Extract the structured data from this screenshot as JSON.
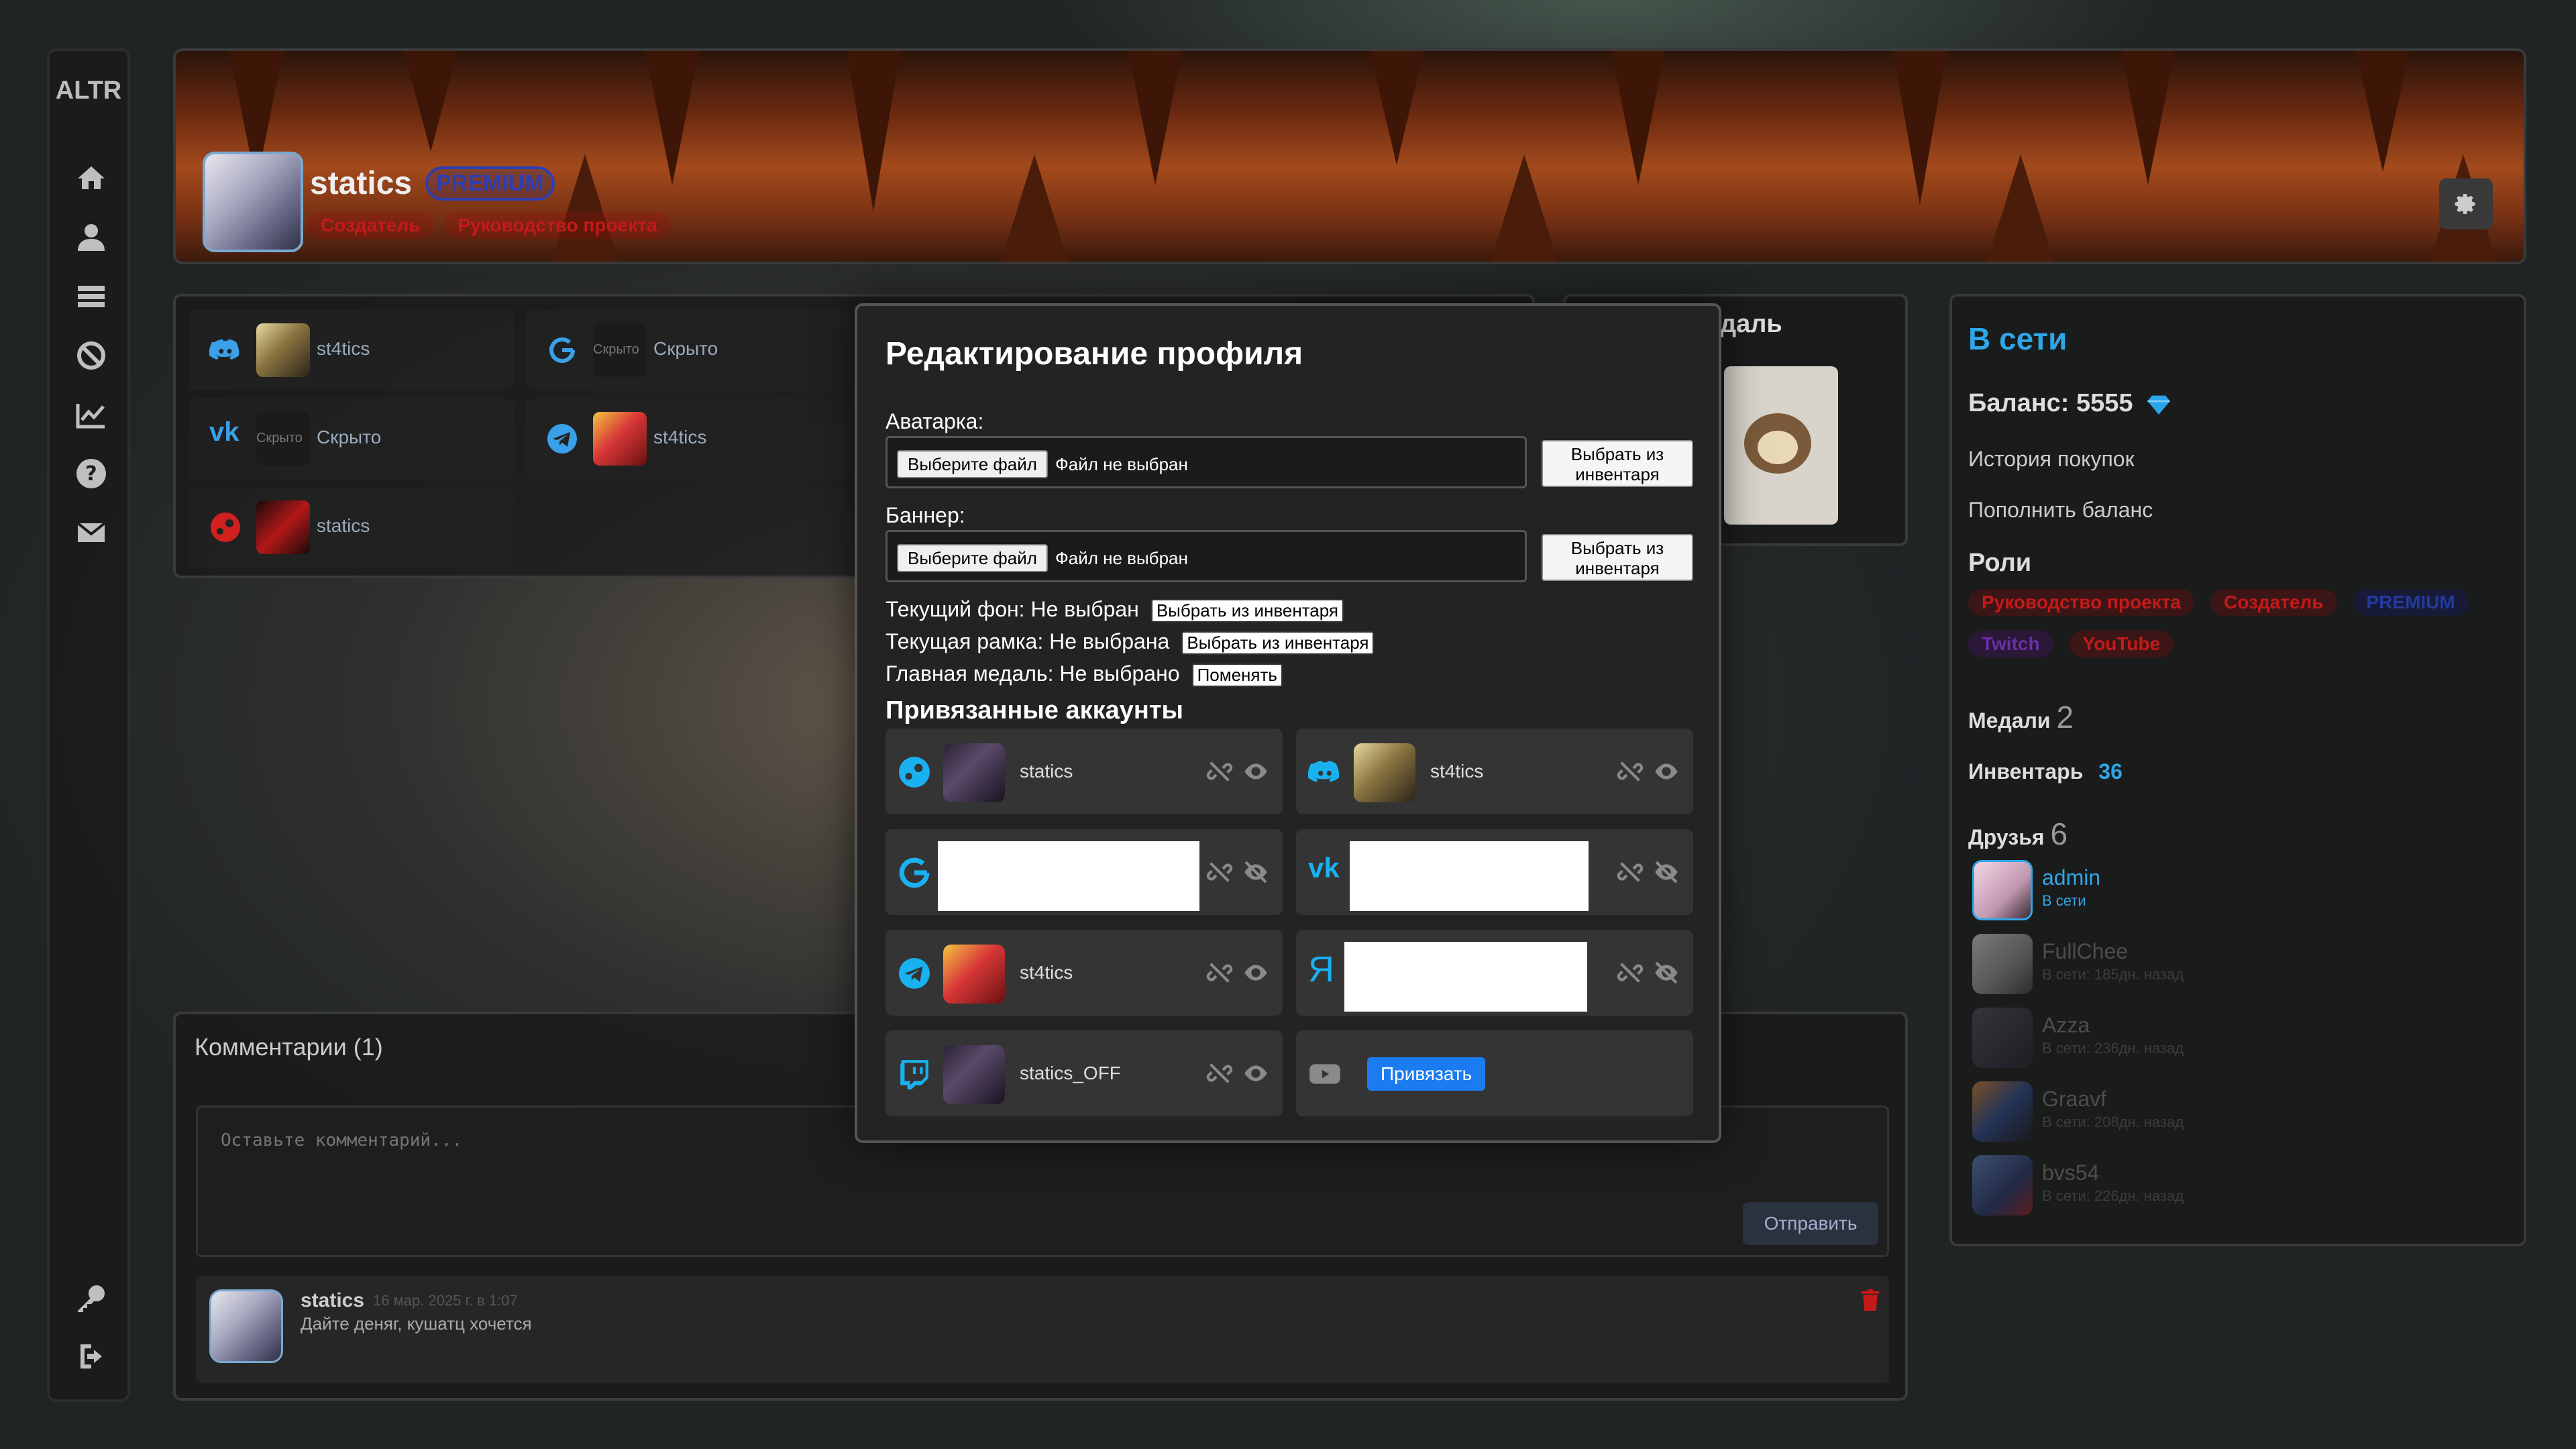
{
  "sidebar": {
    "logo": "ALTR"
  },
  "profile": {
    "username": "statics",
    "premium_badge": "PREMIUM",
    "roles": [
      "Создатель",
      "Руководство проекта"
    ]
  },
  "social": [
    {
      "network": "discord",
      "text": "st4tics"
    },
    {
      "network": "google",
      "small": "Скрыто",
      "text": "Скрыто"
    },
    {
      "network": "vk",
      "small": "Скрыто",
      "text": "Скрыто"
    },
    {
      "network": "telegram",
      "text": "st4tics"
    },
    {
      "network": "steam",
      "text": "statics"
    }
  ],
  "medal": {
    "title_fragment": "даль"
  },
  "right": {
    "online": "В сети",
    "balance": "Баланс: 5555",
    "history": "История покупок",
    "topup": "Пополнить баланс",
    "roles_title": "Роли",
    "roles": [
      "Руководство проекта",
      "Создатель",
      "PREMIUM",
      "Twitch",
      "YouTube"
    ],
    "medals_label": "Медали",
    "medals_count": "2",
    "inventory_label": "Инвентарь",
    "inventory_count": "36",
    "friends_label": "Друзья",
    "friends_count": "6",
    "friends": [
      {
        "name": "admin",
        "status": "В сети"
      },
      {
        "name": "FullChee",
        "status": "В сети: 185дн. назад"
      },
      {
        "name": "Azza",
        "status": "В сети: 236дн. назад"
      },
      {
        "name": "Graavf",
        "status": "В сети: 208дн. назад"
      },
      {
        "name": "bvs54",
        "status": "В сети: 226дн. назад"
      }
    ]
  },
  "comments": {
    "title": "Комментарии (1)",
    "placeholder": "Оставьте комментарий...",
    "send": "Отправить",
    "items": [
      {
        "author": "statics",
        "date": "16 мар. 2025 г. в 1:07",
        "text": "Дайте деняг, кушатц хочется"
      }
    ]
  },
  "modal": {
    "title": "Редактирование профиля",
    "avatar_label": "Аватарка:",
    "banner_label": "Баннер:",
    "file_button": "Выберите файл",
    "file_none": "Файл не выбран",
    "inventory_button": "Выбрать из инвентаря",
    "bg_text": "Текущий фон: Не выбран",
    "frame_text": "Текущая рамка: Не выбрана",
    "medal_text": "Главная медаль: Не выбрано",
    "choose_inv_small": "Выбрать из инвентаря",
    "change": "Поменять",
    "linked_title": "Привязанные аккаунты",
    "accounts": [
      {
        "network": "steam",
        "name": "statics"
      },
      {
        "network": "discord",
        "name": "st4tics"
      },
      {
        "network": "google",
        "name": ""
      },
      {
        "network": "vk",
        "name": ""
      },
      {
        "network": "telegram",
        "name": "st4tics"
      },
      {
        "network": "yandex",
        "name": ""
      },
      {
        "network": "twitch",
        "name": "statics_OFF"
      },
      {
        "network": "youtube",
        "name": ""
      }
    ],
    "bind_button": "Привязать"
  },
  "colors": {
    "accent": "#2fa6e8",
    "link_icon": "#19b1f0",
    "bind": "#1a7cf0",
    "role_red": "#c41a1a",
    "premium": "#233a9e",
    "twitch": "#6a2fa8"
  }
}
